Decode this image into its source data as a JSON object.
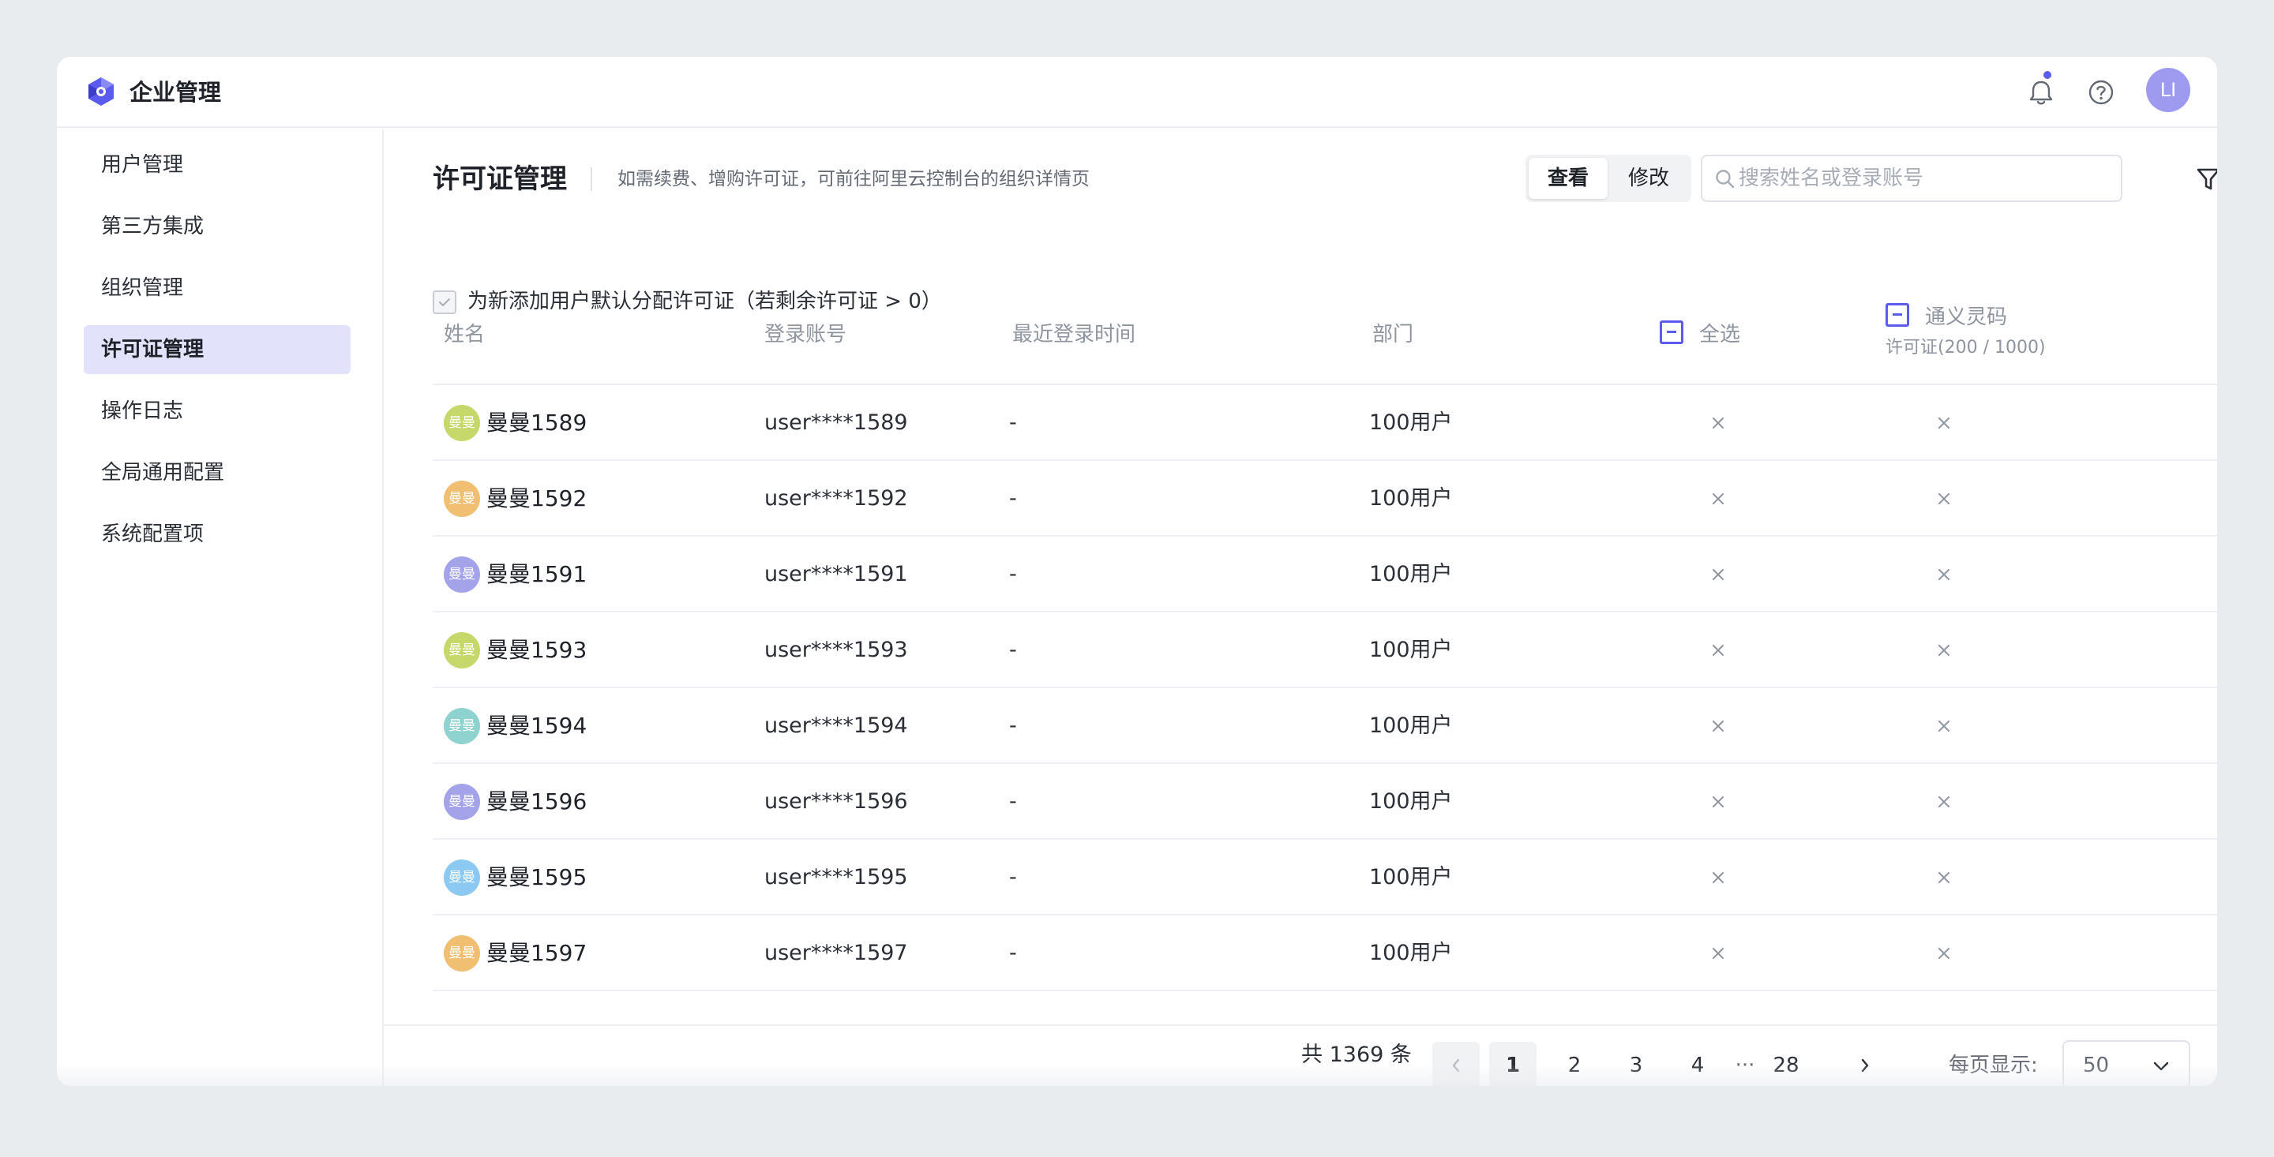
{
  "header": {
    "app_title": "企业管理",
    "avatar_text": "LI",
    "icons": [
      "logo-icon",
      "bell-icon",
      "help-icon"
    ]
  },
  "sidebar": {
    "items": [
      {
        "label": "用户管理",
        "active": false
      },
      {
        "label": "第三方集成",
        "active": false
      },
      {
        "label": "组织管理",
        "active": false
      },
      {
        "label": "许可证管理",
        "active": true
      },
      {
        "label": "操作日志",
        "active": false
      },
      {
        "label": "全局通用配置",
        "active": false
      },
      {
        "label": "系统配置项",
        "active": false
      }
    ]
  },
  "main": {
    "title": "许可证管理",
    "description": "如需续费、增购许可证，可前往阿里云控制台的组织详情页",
    "view_label": "查看",
    "edit_label": "修改",
    "search_placeholder": "搜索姓名或登录账号",
    "default_assign_label": "为新添加用户默认分配许可证（若剩余许可证 > 0）"
  },
  "table": {
    "headers": {
      "name": "姓名",
      "account": "登录账号",
      "last_login": "最近登录时间",
      "department": "部门",
      "select_all": "全选",
      "product": "通义灵码",
      "license_info": "许可证(200 / 1000)"
    },
    "rows": [
      {
        "avatar": "曼曼",
        "avatar_color": "#c6d86a",
        "name": "曼曼1589",
        "account": "user****1589",
        "last_login": "-",
        "department": "100用户"
      },
      {
        "avatar": "曼曼",
        "avatar_color": "#f0bf72",
        "name": "曼曼1592",
        "account": "user****1592",
        "last_login": "-",
        "department": "100用户"
      },
      {
        "avatar": "曼曼",
        "avatar_color": "#a4a3ea",
        "name": "曼曼1591",
        "account": "user****1591",
        "last_login": "-",
        "department": "100用户"
      },
      {
        "avatar": "曼曼",
        "avatar_color": "#c6d86a",
        "name": "曼曼1593",
        "account": "user****1593",
        "last_login": "-",
        "department": "100用户"
      },
      {
        "avatar": "曼曼",
        "avatar_color": "#8ed3d0",
        "name": "曼曼1594",
        "account": "user****1594",
        "last_login": "-",
        "department": "100用户"
      },
      {
        "avatar": "曼曼",
        "avatar_color": "#a4a3ea",
        "name": "曼曼1596",
        "account": "user****1596",
        "last_login": "-",
        "department": "100用户"
      },
      {
        "avatar": "曼曼",
        "avatar_color": "#8cc9f2",
        "name": "曼曼1595",
        "account": "user****1595",
        "last_login": "-",
        "department": "100用户"
      },
      {
        "avatar": "曼曼",
        "avatar_color": "#f0bf72",
        "name": "曼曼1597",
        "account": "user****1597",
        "last_login": "-",
        "department": "100用户"
      }
    ]
  },
  "pagination": {
    "total": "共 1369 条",
    "pages": [
      "1",
      "2",
      "3",
      "4",
      "28"
    ],
    "current": "1",
    "ellipsis": "···",
    "per_page_label": "每页显示:",
    "per_page_value": "50"
  },
  "colors": {
    "accent": "#5b5bf0",
    "active_nav_bg": "#e3e2fb",
    "background": "#e9ecef"
  }
}
